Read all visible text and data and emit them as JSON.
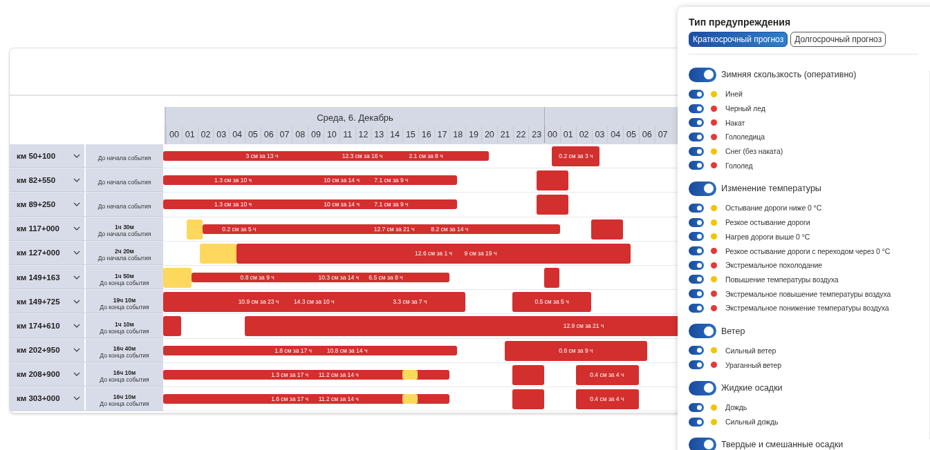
{
  "timeline": {
    "date": "Среда, 6. Декабрь",
    "hours": [
      "00",
      "01",
      "02",
      "03",
      "04",
      "05",
      "06",
      "07",
      "08",
      "09",
      "10",
      "11",
      "12",
      "13",
      "14",
      "15",
      "16",
      "17",
      "18",
      "19",
      "20",
      "21",
      "22",
      "23",
      "00",
      "01",
      "02",
      "03",
      "04",
      "05",
      "06",
      "07"
    ]
  },
  "rows": [
    {
      "location": "км 50+100",
      "status": "До начала события",
      "bars": [
        {
          "kind": "band",
          "color": "#d32f2f"
        },
        {
          "kind": "block",
          "color": "#d32f2f"
        }
      ],
      "labels": [
        "3 см за 13 ч",
        "12.3 см за 16 ч",
        "2.1 см за 8 ч",
        "0.2 см за 3 ч"
      ]
    },
    {
      "location": "км 82+550",
      "status": "До начала события",
      "bars": [
        {
          "kind": "band",
          "color": "#d32f2f"
        },
        {
          "kind": "block",
          "color": "#d32f2f"
        }
      ],
      "labels": [
        "1.3 см за 10 ч",
        "10 см за 14 ч",
        "7.1 см за 9 ч"
      ]
    },
    {
      "location": "км 89+250",
      "status": "До начала события",
      "bars": [
        {
          "kind": "band",
          "color": "#d32f2f"
        },
        {
          "kind": "block",
          "color": "#d32f2f"
        }
      ],
      "labels": [
        "1.3 см за 10 ч",
        "10 см за 14 ч",
        "7.1 см за 9 ч"
      ]
    },
    {
      "location": "км 117+000",
      "duration": "1ч 30м",
      "status": "До начала события",
      "bars": [
        {
          "kind": "block",
          "color": "#fdd85d"
        },
        {
          "kind": "band",
          "color": "#d32f2f"
        },
        {
          "kind": "block",
          "color": "#d32f2f"
        }
      ],
      "labels": [
        "0.2 см за 5 ч",
        "12.7 см за 21 ч",
        "8.2 см за 14 ч"
      ]
    },
    {
      "location": "км 127+000",
      "duration": "2ч 20м",
      "status": "До начала события",
      "bars": [
        {
          "kind": "block",
          "color": "#fdd85d"
        },
        {
          "kind": "block",
          "color": "#d32f2f"
        }
      ],
      "labels": [
        "12.6 см за 1 ч",
        "9 см за 19 ч"
      ]
    },
    {
      "location": "км 149+163",
      "duration": "1ч 50м",
      "status": "До конца события",
      "bars": [
        {
          "kind": "block",
          "color": "#fdd85d"
        },
        {
          "kind": "band",
          "color": "#d32f2f"
        },
        {
          "kind": "block",
          "color": "#d32f2f"
        }
      ],
      "labels": [
        "0.8 см за 9 ч",
        "10.3 см за 14 ч",
        "6.5 см за 8 ч"
      ]
    },
    {
      "location": "км 149+725",
      "duration": "19ч 10м",
      "status": "До конца события",
      "bars": [
        {
          "kind": "block",
          "color": "#d32f2f"
        },
        {
          "kind": "block",
          "color": "#d32f2f"
        }
      ],
      "labels": [
        "10.9 см за 23 ч",
        "14.3 см за 10 ч",
        "3.3 см за 7 ч",
        "0.5 см за 5 ч"
      ]
    },
    {
      "location": "км 174+610",
      "duration": "1ч 10м",
      "status": "До конца события",
      "bars": [
        {
          "kind": "block",
          "color": "#d32f2f"
        },
        {
          "kind": "block",
          "color": "#d32f2f"
        }
      ],
      "labels": [
        "12.9 см за 21 ч"
      ]
    },
    {
      "location": "км 202+950",
      "duration": "16ч 40м",
      "status": "До конца события",
      "bars": [
        {
          "kind": "band",
          "color": "#d32f2f"
        },
        {
          "kind": "block",
          "color": "#d32f2f"
        }
      ],
      "labels": [
        "1.8 см за 17 ч",
        "10.8 см за 14 ч",
        "0.6 см за 9 ч"
      ]
    },
    {
      "location": "км 208+900",
      "duration": "16ч 10м",
      "status": "До конца события",
      "bars": [
        {
          "kind": "band",
          "color": "#d32f2f"
        },
        {
          "kind": "band",
          "color": "#fdd85d"
        },
        {
          "kind": "block",
          "color": "#d32f2f"
        },
        {
          "kind": "block",
          "color": "#d32f2f"
        }
      ],
      "labels": [
        "1.3 см за 17 ч",
        "11.2 см за 14 ч",
        "0.4 см за 4 ч"
      ]
    },
    {
      "location": "км 303+000",
      "duration": "16ч 10м",
      "status": "До конца события",
      "bars": [
        {
          "kind": "band",
          "color": "#d32f2f"
        },
        {
          "kind": "band",
          "color": "#fdd85d"
        },
        {
          "kind": "block",
          "color": "#d32f2f"
        },
        {
          "kind": "block",
          "color": "#d32f2f"
        }
      ],
      "labels": [
        "1.6 см за 17 ч",
        "11.2 см за 14 ч",
        "0.4 см за 4 ч"
      ]
    }
  ],
  "panel": {
    "title": "Тип предупреждения",
    "tabs": [
      {
        "label": "Краткосрочный прогноз",
        "selected": true
      },
      {
        "label": "Долгосрочный прогноз",
        "selected": false
      }
    ],
    "groups": [
      {
        "label": "Зимняя скользкость (оперативно)",
        "on": true,
        "items": [
          {
            "label": "Иней",
            "on": true,
            "color": "#f2c400"
          },
          {
            "label": "Черный лед",
            "on": true,
            "color": "#e53935"
          },
          {
            "label": "Накат",
            "on": true,
            "color": "#e53935"
          },
          {
            "label": "Гололедица",
            "on": true,
            "color": "#e53935"
          },
          {
            "label": "Снег (без наката)",
            "on": true,
            "color": "#f2c400"
          },
          {
            "label": "Гололед",
            "on": true,
            "color": "#e53935"
          }
        ]
      },
      {
        "label": "Изменение температуры",
        "on": true,
        "items": [
          {
            "label": "Остывание дороги ниже 0 °C",
            "on": true,
            "color": "#f2c400"
          },
          {
            "label": "Резкое остывание дороги",
            "on": true,
            "color": "#f2c400"
          },
          {
            "label": "Нагрев дороги выше 0 °C",
            "on": true,
            "color": "#f2c400"
          },
          {
            "label": "Резкое остывание дороги с переходом через 0 °C",
            "on": true,
            "color": "#e53935"
          },
          {
            "label": "Экстремальное похолодание",
            "on": true,
            "color": "#e53935"
          },
          {
            "label": "Повышение температуры воздуха",
            "on": true,
            "color": "#f2c400"
          },
          {
            "label": "Экстремальное повышение температуры воздуха",
            "on": true,
            "color": "#e53935"
          },
          {
            "label": "Экстремальное понижение температуры воздуха",
            "on": true,
            "color": "#e53935"
          }
        ]
      },
      {
        "label": "Ветер",
        "on": true,
        "items": [
          {
            "label": "Сильный ветер",
            "on": true,
            "color": "#f2c400"
          },
          {
            "label": "Ураганный ветер",
            "on": true,
            "color": "#e53935"
          }
        ]
      },
      {
        "label": "Жидкие осадки",
        "on": true,
        "items": [
          {
            "label": "Дождь",
            "on": true,
            "color": "#f2c400"
          },
          {
            "label": "Сильный дождь",
            "on": true,
            "color": "#f2c400"
          }
        ]
      },
      {
        "label": "Твердые и смешанные осадки",
        "on": true
      }
    ]
  }
}
